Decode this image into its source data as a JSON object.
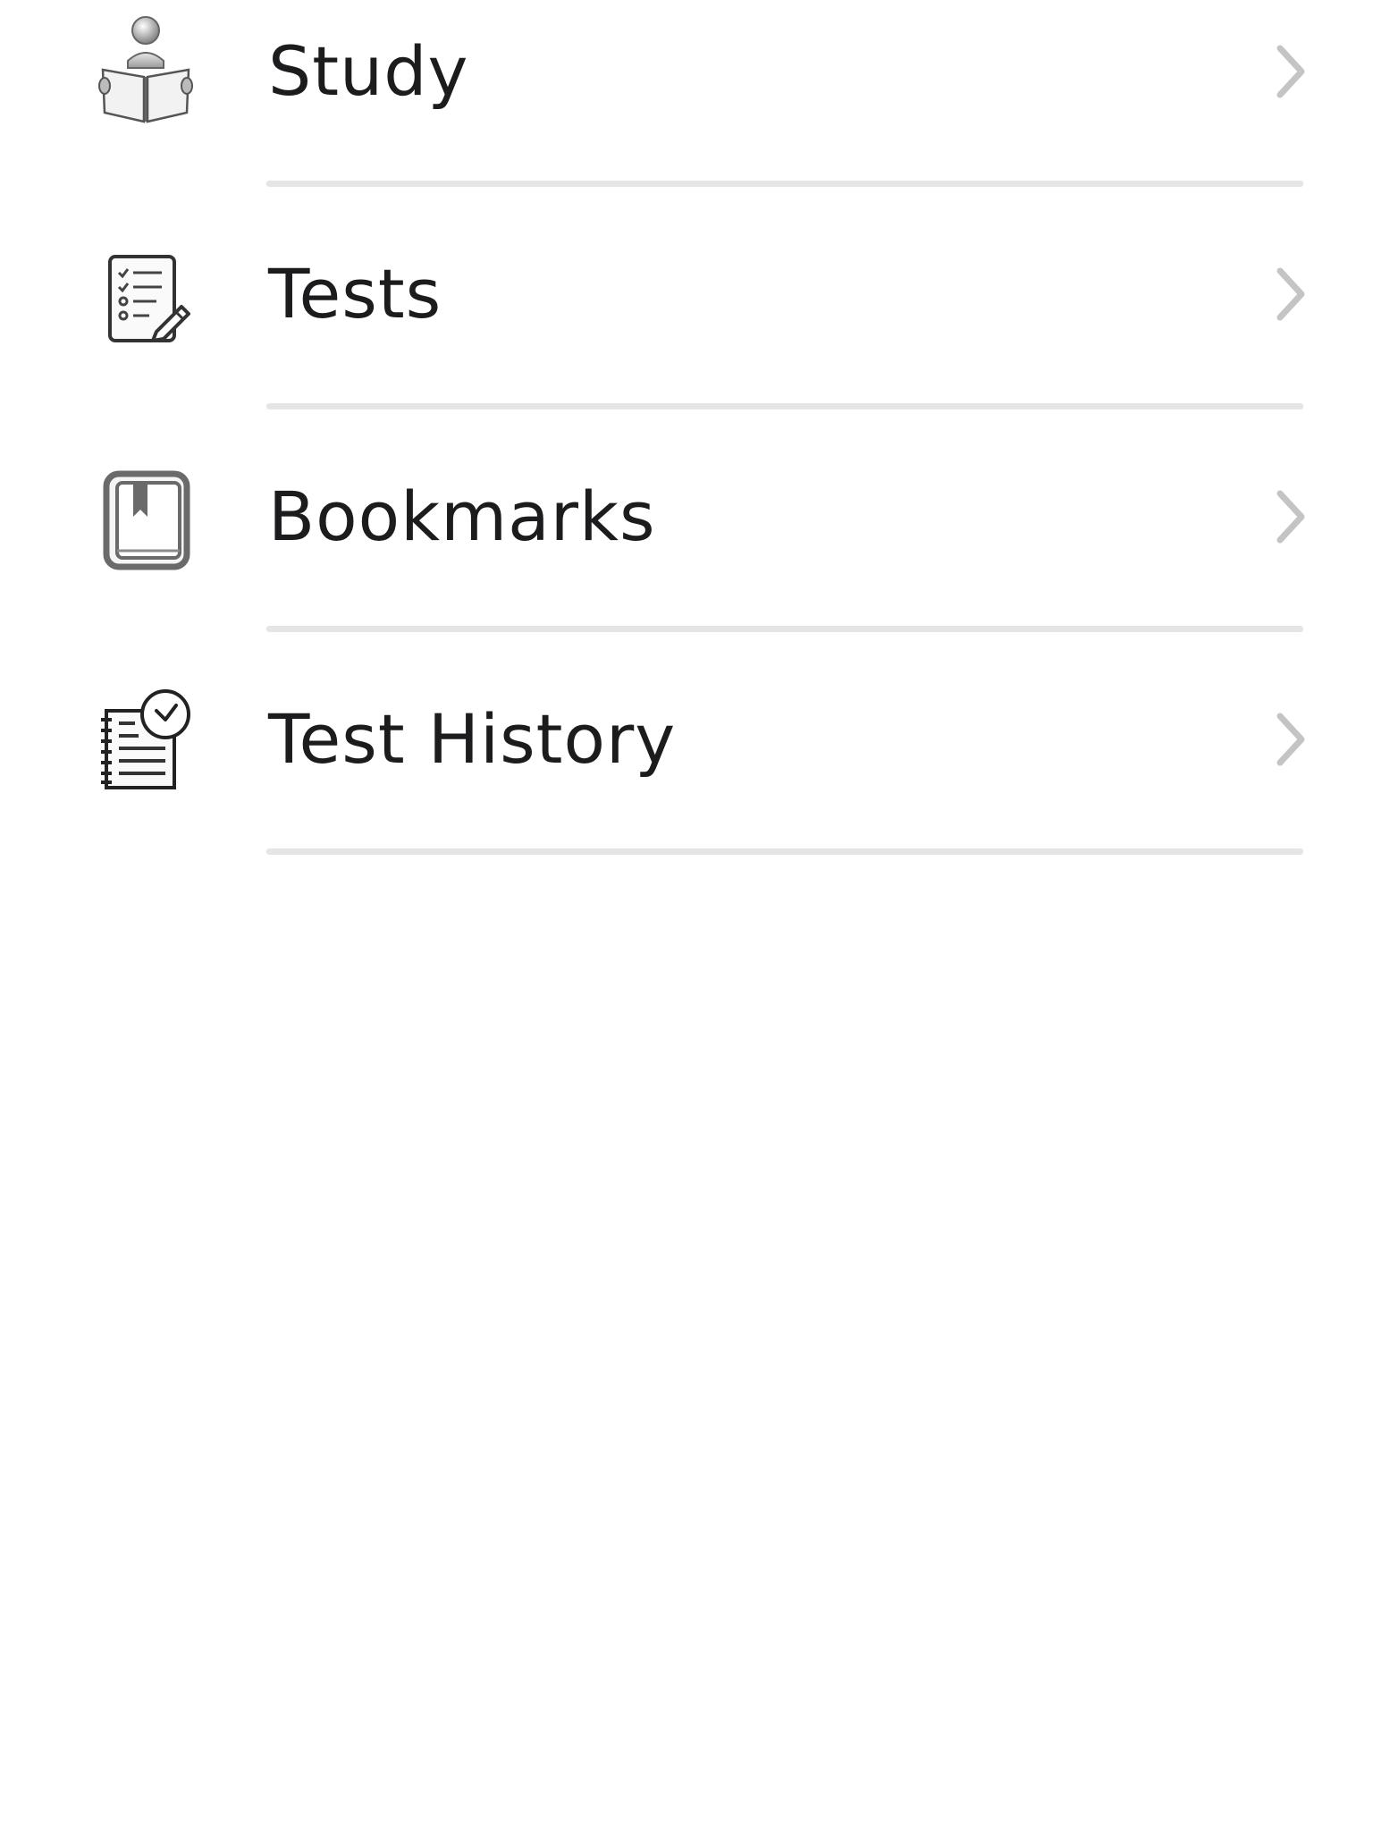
{
  "menu": {
    "items": [
      {
        "label": "Study",
        "icon": "person-reading-book-icon"
      },
      {
        "label": "Tests",
        "icon": "checklist-pencil-icon"
      },
      {
        "label": "Bookmarks",
        "icon": "bookmark-book-icon"
      },
      {
        "label": "Test History",
        "icon": "notebook-clock-icon"
      }
    ]
  },
  "colors": {
    "text": "#1c1c1e",
    "separator": "#e5e5e7",
    "chevron": "#c4c4c6",
    "icon": "#555555"
  }
}
